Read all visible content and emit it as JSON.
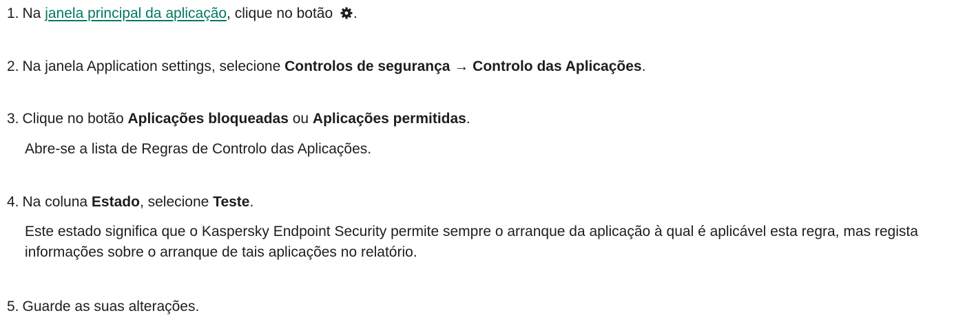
{
  "steps": [
    {
      "number": "1.",
      "prefix": "Na ",
      "link": "janela principal da aplicação",
      "middle": ", clique no botão ",
      "icon": "gear-icon",
      "suffix": "."
    },
    {
      "number": "2.",
      "prefix": "Na janela Application settings, selecione ",
      "strong1": "Controlos de segurança",
      "arrow": " → ",
      "strong2": "Controlo das Aplicações",
      "suffix": "."
    },
    {
      "number": "3.",
      "prefix": "Clique no botão ",
      "strong1": "Aplicações bloqueadas",
      "middle": " ou ",
      "strong2": "Aplicações permitidas",
      "suffix": ".",
      "note": "Abre-se a lista de Regras de Controlo das Aplicações."
    },
    {
      "number": "4.",
      "prefix": "Na coluna ",
      "strong1": "Estado",
      "middle": ", selecione ",
      "strong2": "Teste",
      "suffix": ".",
      "note": "Este estado significa que o Kaspersky Endpoint Security permite sempre o arranque da aplicação à qual é aplicável esta regra, mas regista informações sobre o arranque de tais aplicações no relatório."
    },
    {
      "number": "5.",
      "text": "Guarde as suas alterações."
    }
  ],
  "colors": {
    "link": "#00795c",
    "text": "#1d1d1b"
  }
}
